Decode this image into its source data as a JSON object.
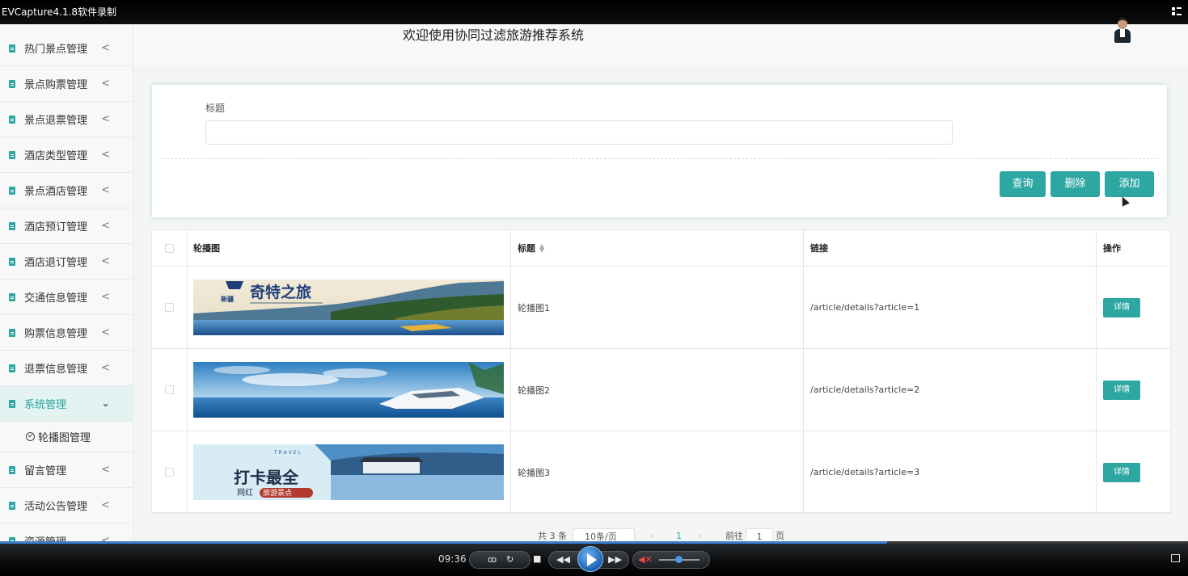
{
  "recorder": {
    "title": "EVCapture4.1.8软件录制"
  },
  "header": {
    "title": "欢迎使用协同过滤旅游推荐系统"
  },
  "sidebar": {
    "items": [
      {
        "label": "热门景点管理"
      },
      {
        "label": "景点购票管理"
      },
      {
        "label": "景点退票管理"
      },
      {
        "label": "酒店类型管理"
      },
      {
        "label": "景点酒店管理"
      },
      {
        "label": "酒店预订管理"
      },
      {
        "label": "酒店退订管理"
      },
      {
        "label": "交通信息管理"
      },
      {
        "label": "购票信息管理"
      },
      {
        "label": "退票信息管理"
      },
      {
        "label": "系统管理",
        "active": true
      },
      {
        "label": "留言管理"
      },
      {
        "label": "活动公告管理"
      },
      {
        "label": "资源管理"
      }
    ],
    "sub_item": "轮播图管理",
    "chev_collapsed": "<",
    "chev_expanded": "⌄"
  },
  "search": {
    "label": "标题",
    "input_value": "",
    "query_label": "查询",
    "delete_label": "删除",
    "add_label": "添加"
  },
  "table": {
    "columns": {
      "image": "轮播图",
      "title": "标题",
      "link": "链接",
      "op": "操作"
    },
    "rows": [
      {
        "title": "轮播图1",
        "link": "/article/details?article=1",
        "btn": "详情",
        "banner_text": "奇特之旅",
        "banner_sub": "新疆"
      },
      {
        "title": "轮播图2",
        "link": "/article/details?article=2",
        "btn": "详情"
      },
      {
        "title": "轮播图3",
        "link": "/article/details?article=3",
        "btn": "详情",
        "banner_text": "打卡最全",
        "banner_sub": "网红",
        "banner_tag": "旅游景点",
        "banner_travel": "T R A V E L"
      }
    ]
  },
  "pager": {
    "total": "共 3 条",
    "size": "10条/页",
    "prev": "‹",
    "current": "1",
    "next": "›",
    "goto": "前往",
    "goto_value": "1",
    "unit": "页"
  },
  "player": {
    "time": "09:36"
  },
  "colors": {
    "accent": "#2ea7a3",
    "progress": "#3a7fd0"
  }
}
